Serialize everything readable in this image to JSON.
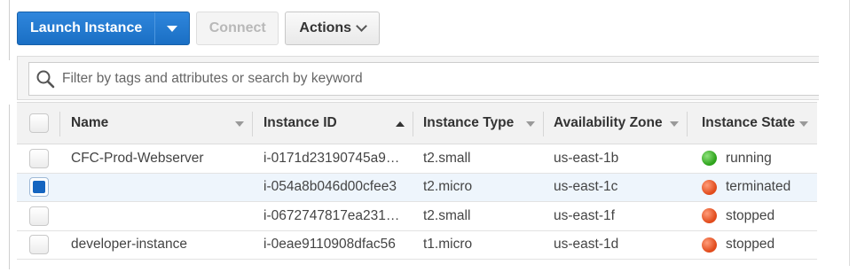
{
  "toolbar": {
    "launch_label": "Launch Instance",
    "connect_label": "Connect",
    "actions_label": "Actions"
  },
  "filter": {
    "placeholder": "Filter by tags and attributes or search by keyword",
    "value": ""
  },
  "table": {
    "columns": [
      "Name",
      "Instance ID",
      "Instance Type",
      "Availability Zone",
      "Instance State"
    ],
    "sorted_column": "Instance ID",
    "sort_direction": "ascending",
    "rows": [
      {
        "selected": false,
        "name": "CFC-Prod-Webserver",
        "instance_id": "i-0171d23190745a9…",
        "type": "t2.small",
        "zone": "us-east-1b",
        "state": "running",
        "state_color": "#2ea31c"
      },
      {
        "selected": true,
        "name": "",
        "instance_id": "i-054a8b046d00cfee3",
        "type": "t2.micro",
        "zone": "us-east-1c",
        "state": "terminated",
        "state_color": "#e14b1c"
      },
      {
        "selected": false,
        "name": "",
        "instance_id": "i-0672747817ea231…",
        "type": "t2.small",
        "zone": "us-east-1f",
        "state": "stopped",
        "state_color": "#e14b1c"
      },
      {
        "selected": false,
        "name": "developer-instance",
        "instance_id": "i-0eae9110908dfac56",
        "type": "t1.micro",
        "zone": "us-east-1d",
        "state": "stopped",
        "state_color": "#e14b1c"
      }
    ]
  },
  "colors": {
    "primary_button": "#1a6fc4",
    "selected_row": "#eef5fc",
    "running": "#2ea31c",
    "stopped": "#e14b1c"
  },
  "icons": {
    "launch_dropdown": "caret-down-icon",
    "actions_dropdown": "chevron-down-icon",
    "filter": "search-icon"
  }
}
